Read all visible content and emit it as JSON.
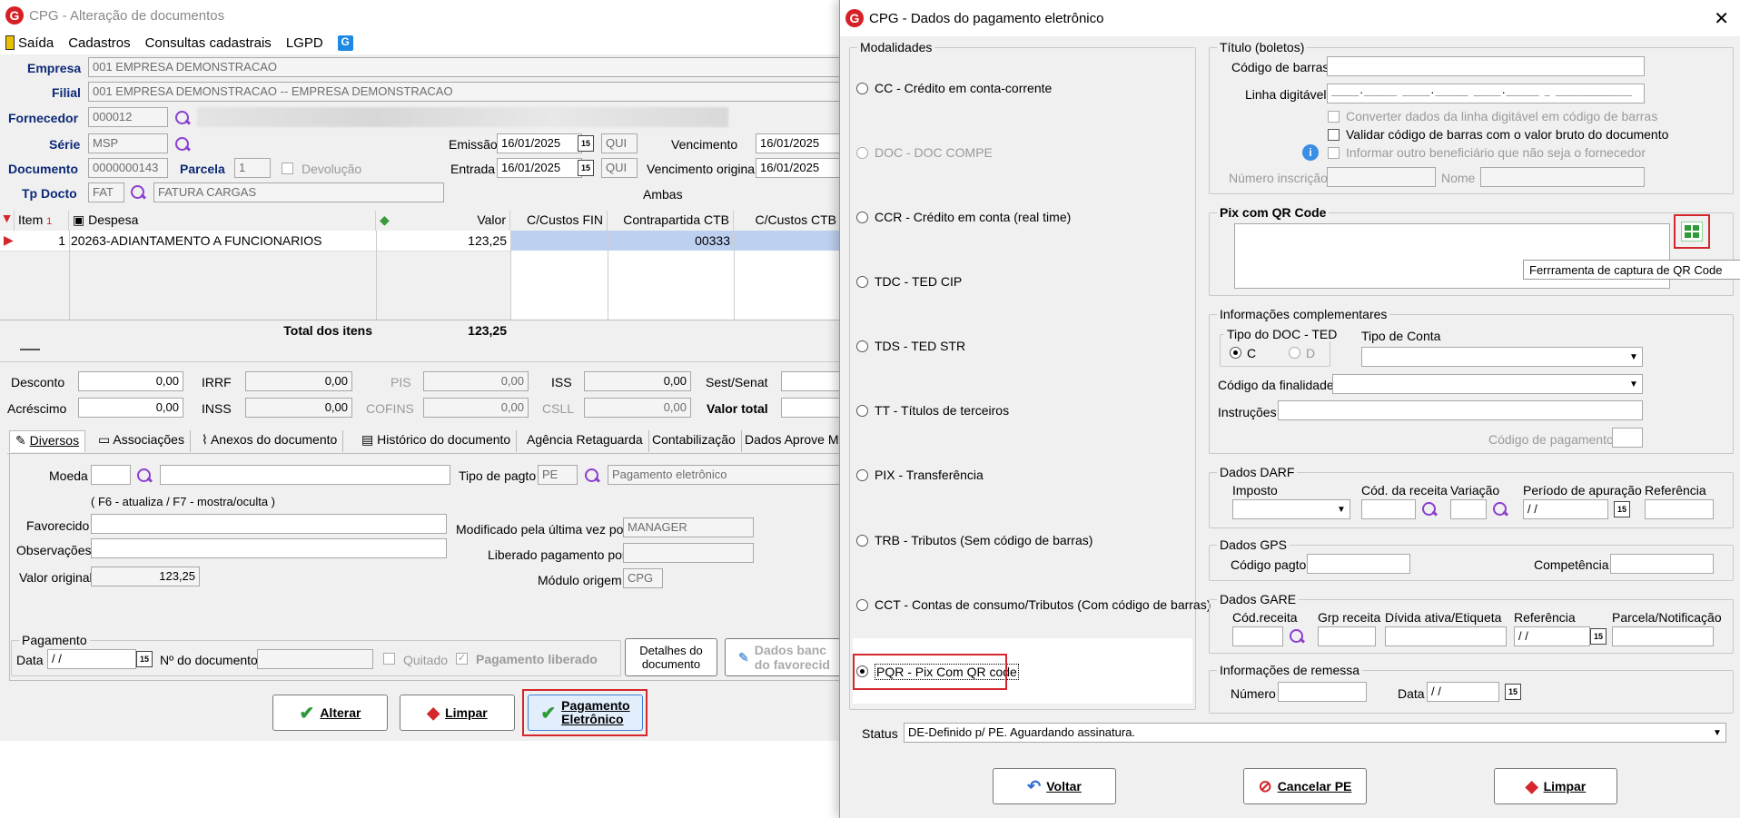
{
  "main": {
    "title": "CPG - Alteração de documentos",
    "menu": [
      "Saída",
      "Cadastros",
      "Consultas cadastrais",
      "LGPD"
    ],
    "empresa_label": "Empresa",
    "empresa": "001 EMPRESA DEMONSTRACAO",
    "filial_label": "Filial",
    "filial": "001 EMPRESA DEMONSTRACAO -- EMPRESA DEMONSTRACAO",
    "fornecedor_label": "Fornecedor",
    "fornecedor": "000012",
    "serie_label": "Série",
    "serie": "MSP",
    "documento_label": "Documento",
    "documento": "0000000143",
    "parcela_label": "Parcela",
    "parcela": "1",
    "devolucao": "Devolução",
    "tpdocto_label": "Tp Docto",
    "tpdocto": "FAT",
    "tpdocto_desc": "FATURA CARGAS",
    "emissao_label": "Emissão",
    "emissao": "16/01/2025",
    "emissao_dia": "QUI",
    "entrada_label": "Entrada",
    "entrada": "16/01/2025",
    "entrada_dia": "QUI",
    "vencimento_label": "Vencimento",
    "vencimento": "16/01/2025",
    "venc_original_label": "Vencimento original",
    "venc_original": "16/01/2025",
    "ambas": "Ambas",
    "grid_headers": [
      "Item",
      "Despesa",
      "Valor",
      "C/Custos FIN",
      "Contrapartida CTB",
      "C/Custos CTB"
    ],
    "row": {
      "item": "1",
      "despesa": "20263-ADIANTAMENTO A FUNCIONARIOS",
      "valor": "123,25",
      "contrapartida": "00333"
    },
    "total_label": "Total dos itens",
    "total": "123,25",
    "desconto_label": "Desconto",
    "desconto": "0,00",
    "acrescimo_label": "Acréscimo",
    "acrescimo": "0,00",
    "irrf_label": "IRRF",
    "irrf": "0,00",
    "inss_label": "INSS",
    "inss": "0,00",
    "pis_label": "PIS",
    "pis": "0,00",
    "cofins_label": "COFINS",
    "cofins": "0,00",
    "iss_label": "ISS",
    "iss": "0,00",
    "csll_label": "CSLL",
    "csll": "0,00",
    "sestsenat_label": "Sest/Senat",
    "valortotal_label": "Valor total",
    "tabs": [
      "Diversos",
      "Associações",
      "Anexos do documento",
      "Histórico do documento",
      "Agência Retaguarda",
      "Contabilização",
      "Dados Aprove Me"
    ],
    "moeda_label": "Moeda",
    "tipopagto_label": "Tipo de pagto",
    "tipopagto": "PE",
    "tipopagto_desc": "Pagamento eletrônico",
    "f6_hint": "( F6 - atualiza / F7 - mostra/oculta )",
    "favorecido_label": "Favorecido",
    "observacoes_label": "Observações",
    "valororiginal_label": "Valor original",
    "valororiginal": "123,25",
    "modificado_label": "Modificado pela última vez por",
    "modificado": "MANAGER",
    "liberado_label": "Liberado pagamento por",
    "modulo_label": "Módulo origem",
    "modulo": "CPG",
    "pagamento_group": "Pagamento",
    "data_label": "Data",
    "data_val": " /  /",
    "ndoc_label": "Nº do documento",
    "quitado": "Quitado",
    "pag_liberado": "Pagamento liberado",
    "detalhes_btn_1": "Detalhes do",
    "detalhes_btn_2": "documento",
    "dados_banc_1": "Dados banc",
    "dados_banc_2": "do favorecid",
    "alterar_btn": "Alterar",
    "limpar_btn": "Limpar",
    "pag_elet_1": "Pagamento",
    "pag_elet_2": "Eletrônico"
  },
  "dialog": {
    "title": "CPG - Dados do pagamento eletrônico",
    "modalidades_title": "Modalidades",
    "modalidades": [
      "CC  - Crédito em conta-corrente",
      "DOC - DOC COMPE",
      "CCR - Crédito em conta (real time)",
      "TDC - TED CIP",
      "TDS - TED STR",
      "TT  - Títulos de terceiros",
      "PIX - Transferência",
      "TRB - Tributos (Sem código de barras)",
      "CCT - Contas de consumo/Tributos (Com código de barras)",
      "PQR - Pix Com QR code"
    ],
    "titulo_group": "Título (boletos)",
    "codbarras_label": "Código de barras",
    "linhadig_label": "Linha digitável",
    "linhadig_mask": "_____.______ _____.______ _____.______ _ ______________",
    "converter": "Converter dados da linha digitável em código de barras",
    "validar": "Validar código de barras com o valor bruto do documento",
    "informar": "Informar outro beneficiário que não seja o fornecedor",
    "numinsc_label": "Número inscrição",
    "nome_label": "Nome",
    "pix_group": "Pix com QR Code",
    "tooltip": "Ferrramenta de captura de QR Code",
    "infocomp_group": "Informações complementares",
    "tipodoc_group": "Tipo do DOC - TED",
    "tipo_c": "C",
    "tipo_d": "D",
    "tipoconta_label": "Tipo de Conta",
    "codfin_label": "Código da finalidade",
    "instrucoes_label": "Instruções",
    "codpag_label": "Código de pagamento",
    "darf_group": "Dados DARF",
    "imposto_label": "Imposto",
    "codreceita_label": "Cód. da receita",
    "variacao_label": "Variação",
    "periodo_label": "Período de apuração",
    "referencia_label": "Referência",
    "date_mask": " /  /",
    "gps_group": "Dados GPS",
    "codpagto_label": "Código pagto",
    "competencia_label": "Competência",
    "gare_group": "Dados GARE",
    "gare_codrec": "Cód.receita",
    "gare_grp": "Grp receita",
    "gare_divida": "Dívida ativa/Etiqueta",
    "gare_ref": "Referência",
    "gare_parcela": "Parcela/Notificação",
    "remessa_group": "Informações de remessa",
    "numero_label": "Número",
    "data_label": "Data",
    "status_label": "Status",
    "status": "DE-Definido p/ PE. Aguardando assinatura.",
    "voltar_btn": "Voltar",
    "cancelar_btn": "Cancelar PE",
    "limpar_btn": "Limpar"
  }
}
